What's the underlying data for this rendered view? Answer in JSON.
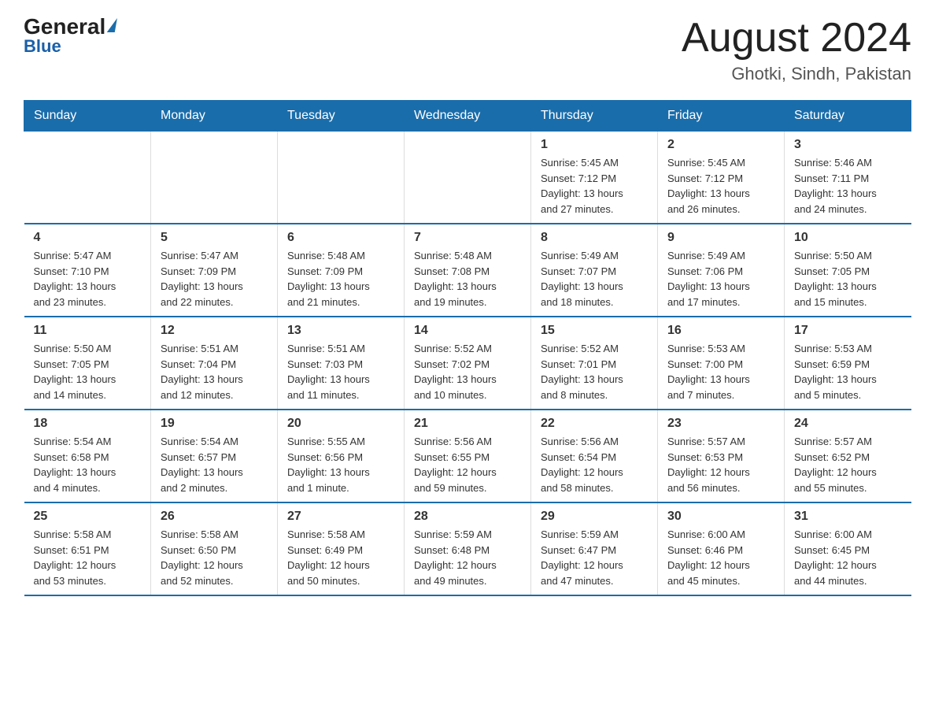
{
  "header": {
    "logo_general": "General",
    "logo_blue": "Blue",
    "month_year": "August 2024",
    "location": "Ghotki, Sindh, Pakistan"
  },
  "days_of_week": [
    "Sunday",
    "Monday",
    "Tuesday",
    "Wednesday",
    "Thursday",
    "Friday",
    "Saturday"
  ],
  "weeks": [
    [
      {
        "day": "",
        "info": ""
      },
      {
        "day": "",
        "info": ""
      },
      {
        "day": "",
        "info": ""
      },
      {
        "day": "",
        "info": ""
      },
      {
        "day": "1",
        "info": "Sunrise: 5:45 AM\nSunset: 7:12 PM\nDaylight: 13 hours\nand 27 minutes."
      },
      {
        "day": "2",
        "info": "Sunrise: 5:45 AM\nSunset: 7:12 PM\nDaylight: 13 hours\nand 26 minutes."
      },
      {
        "day": "3",
        "info": "Sunrise: 5:46 AM\nSunset: 7:11 PM\nDaylight: 13 hours\nand 24 minutes."
      }
    ],
    [
      {
        "day": "4",
        "info": "Sunrise: 5:47 AM\nSunset: 7:10 PM\nDaylight: 13 hours\nand 23 minutes."
      },
      {
        "day": "5",
        "info": "Sunrise: 5:47 AM\nSunset: 7:09 PM\nDaylight: 13 hours\nand 22 minutes."
      },
      {
        "day": "6",
        "info": "Sunrise: 5:48 AM\nSunset: 7:09 PM\nDaylight: 13 hours\nand 21 minutes."
      },
      {
        "day": "7",
        "info": "Sunrise: 5:48 AM\nSunset: 7:08 PM\nDaylight: 13 hours\nand 19 minutes."
      },
      {
        "day": "8",
        "info": "Sunrise: 5:49 AM\nSunset: 7:07 PM\nDaylight: 13 hours\nand 18 minutes."
      },
      {
        "day": "9",
        "info": "Sunrise: 5:49 AM\nSunset: 7:06 PM\nDaylight: 13 hours\nand 17 minutes."
      },
      {
        "day": "10",
        "info": "Sunrise: 5:50 AM\nSunset: 7:05 PM\nDaylight: 13 hours\nand 15 minutes."
      }
    ],
    [
      {
        "day": "11",
        "info": "Sunrise: 5:50 AM\nSunset: 7:05 PM\nDaylight: 13 hours\nand 14 minutes."
      },
      {
        "day": "12",
        "info": "Sunrise: 5:51 AM\nSunset: 7:04 PM\nDaylight: 13 hours\nand 12 minutes."
      },
      {
        "day": "13",
        "info": "Sunrise: 5:51 AM\nSunset: 7:03 PM\nDaylight: 13 hours\nand 11 minutes."
      },
      {
        "day": "14",
        "info": "Sunrise: 5:52 AM\nSunset: 7:02 PM\nDaylight: 13 hours\nand 10 minutes."
      },
      {
        "day": "15",
        "info": "Sunrise: 5:52 AM\nSunset: 7:01 PM\nDaylight: 13 hours\nand 8 minutes."
      },
      {
        "day": "16",
        "info": "Sunrise: 5:53 AM\nSunset: 7:00 PM\nDaylight: 13 hours\nand 7 minutes."
      },
      {
        "day": "17",
        "info": "Sunrise: 5:53 AM\nSunset: 6:59 PM\nDaylight: 13 hours\nand 5 minutes."
      }
    ],
    [
      {
        "day": "18",
        "info": "Sunrise: 5:54 AM\nSunset: 6:58 PM\nDaylight: 13 hours\nand 4 minutes."
      },
      {
        "day": "19",
        "info": "Sunrise: 5:54 AM\nSunset: 6:57 PM\nDaylight: 13 hours\nand 2 minutes."
      },
      {
        "day": "20",
        "info": "Sunrise: 5:55 AM\nSunset: 6:56 PM\nDaylight: 13 hours\nand 1 minute."
      },
      {
        "day": "21",
        "info": "Sunrise: 5:56 AM\nSunset: 6:55 PM\nDaylight: 12 hours\nand 59 minutes."
      },
      {
        "day": "22",
        "info": "Sunrise: 5:56 AM\nSunset: 6:54 PM\nDaylight: 12 hours\nand 58 minutes."
      },
      {
        "day": "23",
        "info": "Sunrise: 5:57 AM\nSunset: 6:53 PM\nDaylight: 12 hours\nand 56 minutes."
      },
      {
        "day": "24",
        "info": "Sunrise: 5:57 AM\nSunset: 6:52 PM\nDaylight: 12 hours\nand 55 minutes."
      }
    ],
    [
      {
        "day": "25",
        "info": "Sunrise: 5:58 AM\nSunset: 6:51 PM\nDaylight: 12 hours\nand 53 minutes."
      },
      {
        "day": "26",
        "info": "Sunrise: 5:58 AM\nSunset: 6:50 PM\nDaylight: 12 hours\nand 52 minutes."
      },
      {
        "day": "27",
        "info": "Sunrise: 5:58 AM\nSunset: 6:49 PM\nDaylight: 12 hours\nand 50 minutes."
      },
      {
        "day": "28",
        "info": "Sunrise: 5:59 AM\nSunset: 6:48 PM\nDaylight: 12 hours\nand 49 minutes."
      },
      {
        "day": "29",
        "info": "Sunrise: 5:59 AM\nSunset: 6:47 PM\nDaylight: 12 hours\nand 47 minutes."
      },
      {
        "day": "30",
        "info": "Sunrise: 6:00 AM\nSunset: 6:46 PM\nDaylight: 12 hours\nand 45 minutes."
      },
      {
        "day": "31",
        "info": "Sunrise: 6:00 AM\nSunset: 6:45 PM\nDaylight: 12 hours\nand 44 minutes."
      }
    ]
  ]
}
